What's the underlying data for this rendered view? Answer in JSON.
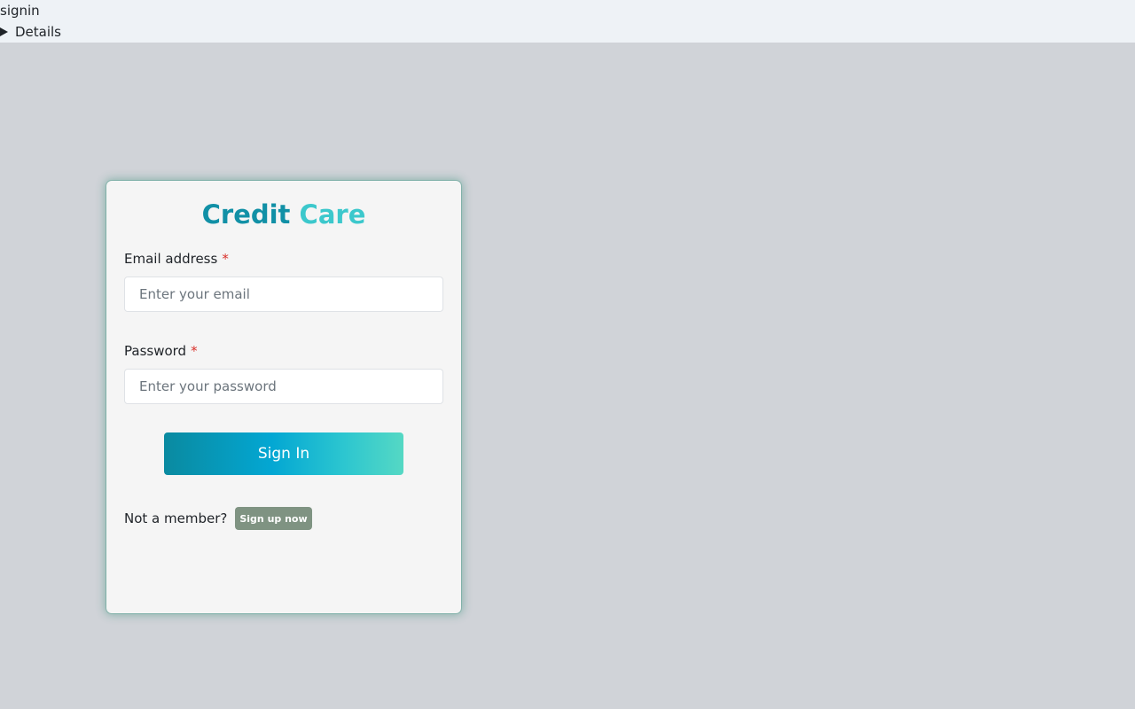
{
  "header": {
    "page_name": "signin",
    "details_label": "Details"
  },
  "brand": {
    "word1": "Credit",
    "word2": "Care",
    "colors": {
      "word1": "#1190a6",
      "word2": "#3cc8cc"
    }
  },
  "form": {
    "email": {
      "label": "Email address",
      "required_mark": "*",
      "placeholder": "Enter your email",
      "value": ""
    },
    "password": {
      "label": "Password",
      "required_mark": "*",
      "placeholder": "Enter your password",
      "value": ""
    },
    "submit_label": "Sign In"
  },
  "footer": {
    "prompt": "Not a member?",
    "signup_label": "Sign up now"
  },
  "colors": {
    "background": "#d0d3d8",
    "card": "#f5f5f5",
    "required": "#d9302a",
    "signup_button": "#7f9382"
  }
}
